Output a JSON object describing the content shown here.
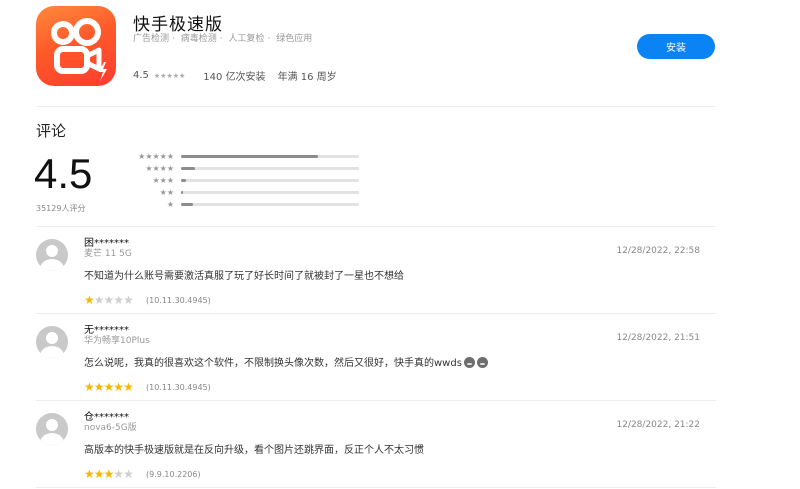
{
  "app": {
    "title": "快手极速版",
    "checks": [
      "广告检测",
      "病毒检测",
      "人工复检",
      "绿色应用"
    ],
    "checks_separator": "·",
    "rating": "4.5",
    "rating_stars": "★★★★★",
    "installs": "140 亿次安装",
    "age": "年满 16 周岁",
    "install_button": "安装"
  },
  "reviews_section": {
    "title": "评论",
    "score": "4.5",
    "count_label": "35129人评分",
    "histogram": [
      {
        "stars": "★★★★★",
        "fraction": 0.77
      },
      {
        "stars": "★★★★",
        "fraction": 0.08
      },
      {
        "stars": "★★★",
        "fraction": 0.03
      },
      {
        "stars": "★★",
        "fraction": 0.01
      },
      {
        "stars": "★",
        "fraction": 0.07
      }
    ]
  },
  "reviews": [
    {
      "name": "困*******",
      "device": "麦芒 11 5G",
      "time": "12/28/2022, 22:58",
      "text": "不知道为什么账号需要激活真服了玩了好长时间了就被封了一星也不想给",
      "rating": 1,
      "version": "(10.11.30.4945)"
    },
    {
      "name": "无*******",
      "device": "华为畅享10Plus",
      "time": "12/28/2022, 21:51",
      "text": "怎么说呢，我真的很喜欢这个软件，不限制换头像次数，然后又很好，快手真的wwds",
      "emojis": [
        "grimace-emoji",
        "grimace-emoji"
      ],
      "rating": 5,
      "version": "(10.11.30.4945)"
    },
    {
      "name": "仓*******",
      "device": "nova6-5G版",
      "time": "12/28/2022, 21:22",
      "text": "高版本的快手极速版就是在反向升级，看个图片还跳界面，反正个人不太习惯",
      "rating": 3,
      "version": "(9.9.10.2206)"
    }
  ],
  "colors": {
    "install_blue": "#0a84f5",
    "star_gold": "#f5b800",
    "icon_orange": "#ff5a2a"
  }
}
